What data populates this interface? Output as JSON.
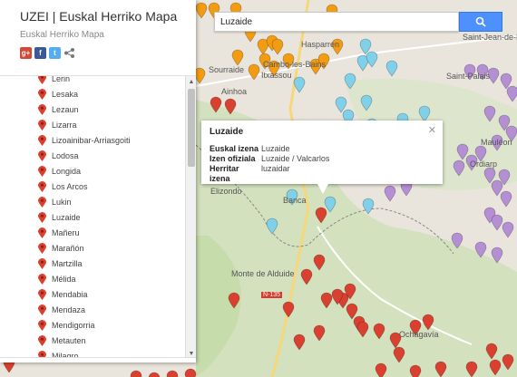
{
  "panel": {
    "title": "UZEI | Euskal Herriko Mapa",
    "subtitle": "Euskal Herriko Mapa",
    "share_icons": [
      "google-plus-icon",
      "facebook-icon",
      "twitter-icon",
      "share-icon"
    ],
    "items": [
      "Lerin",
      "Lesaka",
      "Lezaun",
      "Lizarra",
      "Lizoainibar-Arriasgoiti",
      "Lodosa",
      "Longida",
      "Los Arcos",
      "Lukin",
      "Luzaide",
      "Mañeru",
      "Marañón",
      "Martzilla",
      "Mélida",
      "Mendabia",
      "Mendaza",
      "Mendigorria",
      "Metauten",
      "Milagro"
    ]
  },
  "search": {
    "value": "Luzaide",
    "button_icon": "search-icon"
  },
  "infowindow": {
    "title": "Luzaide",
    "rows": [
      {
        "label": "Euskal izena",
        "value": "Luzaide"
      },
      {
        "label": "Izen ofiziala",
        "value": "Luzaide / Valcarlos"
      },
      {
        "label": "Herritar izena",
        "value": "luzaidar"
      }
    ]
  },
  "map": {
    "labels": [
      "Hasparren",
      "Saint-Jean-de-Beaurn",
      "Saint-Palais",
      "Itxassou",
      "Sourraide",
      "Cambo-les-Bains",
      "Ainhoa",
      "Elizondo",
      "Banca",
      "Ordiarp",
      "Mauléon",
      "Monte de Alduide",
      "N-135",
      "Ochagavía"
    ]
  },
  "colors": {
    "red": "#d9402f",
    "orange": "#f39c12",
    "lightblue": "#7fd0e8",
    "purple": "#b48fd4",
    "blue": "#3b7ddd",
    "accent": "#4d90fe"
  }
}
